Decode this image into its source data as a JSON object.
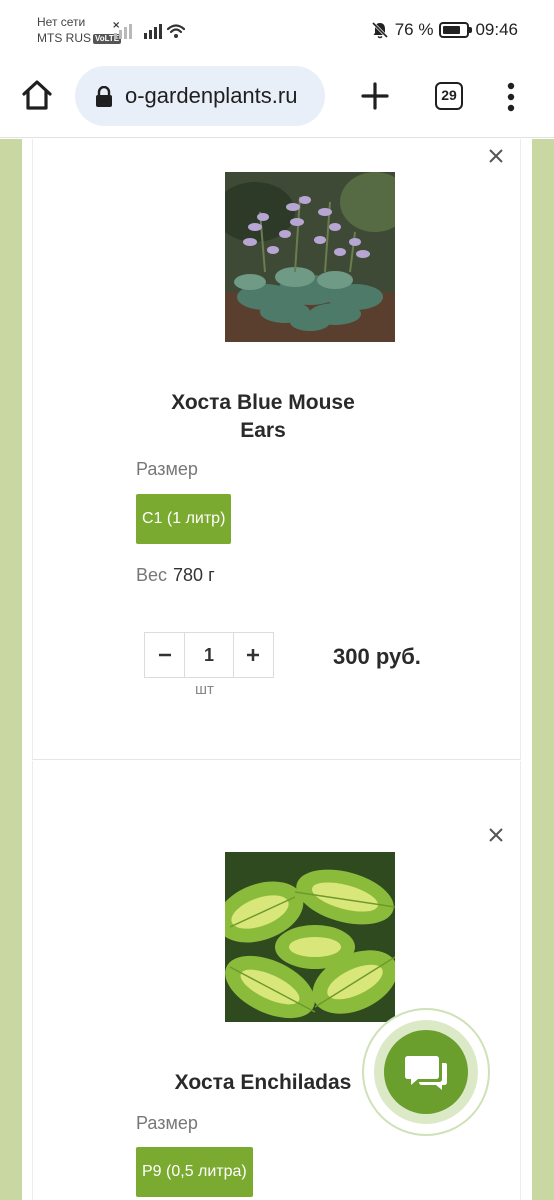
{
  "status_bar": {
    "carrier_line1": "Нет сети",
    "carrier_line2": "MTS RUS",
    "volte": "VoLTE",
    "battery_label": "76 %",
    "battery_level": 0.76,
    "time": "09:46",
    "icons": [
      "signal-x-icon",
      "signal-icon",
      "wifi-icon",
      "bell-muted-icon",
      "battery-icon"
    ]
  },
  "browser": {
    "url": "o-gardenplants.ru",
    "tab_count": "29",
    "icons": [
      "home-icon",
      "lock-icon",
      "plus-icon",
      "tabs-icon",
      "menu-icon"
    ]
  },
  "cart_items": [
    {
      "title": "Хоста Blue Mouse Ears",
      "size_label": "Размер",
      "size_value": "C1 (1 литр)",
      "weight_label": "Вес",
      "weight_value": "780 г",
      "quantity": "1",
      "unit": "шт",
      "price": "300 руб."
    },
    {
      "title": "Хоста Enchiladas",
      "size_label": "Размер",
      "size_value": "P9 (0,5 литра)"
    }
  ],
  "colors": {
    "brand_green": "#7aaa2f",
    "page_background": "#c9d8a2",
    "chat_button": "#6a9e2d"
  }
}
